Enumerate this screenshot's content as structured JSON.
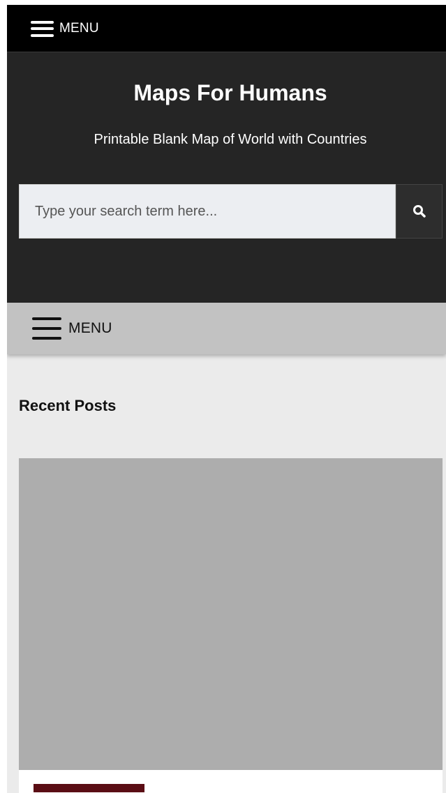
{
  "topbar": {
    "menu_label": "MENU"
  },
  "header": {
    "site_title": "Maps For Humans",
    "tagline": "Printable Blank Map of World with Countries"
  },
  "search": {
    "placeholder": "Type your search term here...",
    "value": "",
    "button_icon": "search-icon"
  },
  "navbar": {
    "menu_label": "MENU"
  },
  "main": {
    "section_heading": "Recent Posts",
    "posts": [
      {
        "thumbnail": "placeholder-image"
      }
    ]
  },
  "colors": {
    "topbar_bg": "#000000",
    "header_bg": "#252525",
    "navbar_bg": "#c2c2c2",
    "page_bg": "#ebebeb",
    "thumbnail_bg": "#adadad",
    "category_accent": "#5a0d14"
  }
}
